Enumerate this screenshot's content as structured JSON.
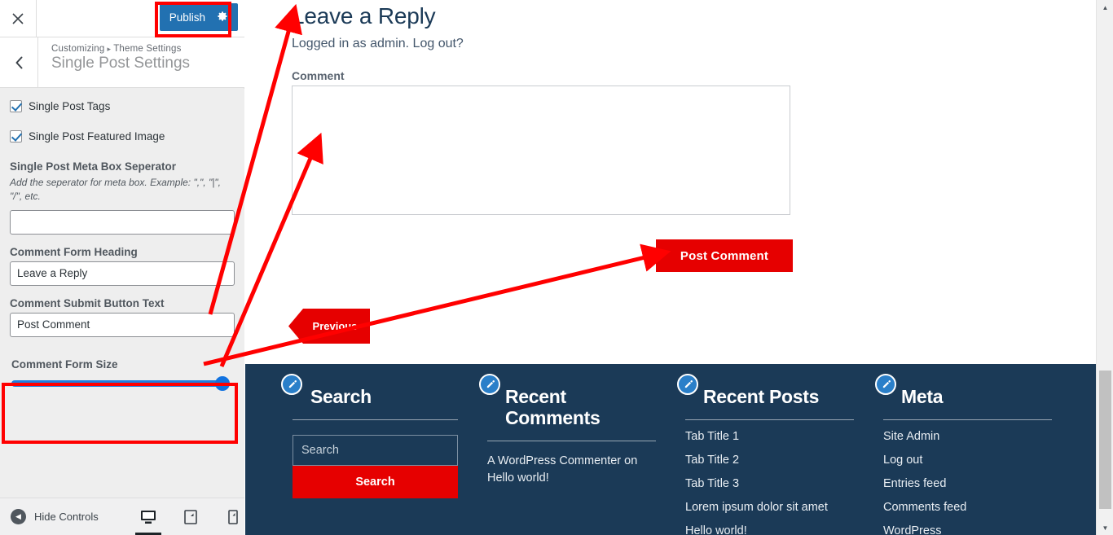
{
  "sidebar": {
    "close_label": "×",
    "publish_label": "Publish",
    "gear_icon": "gear-icon",
    "back_label": "‹",
    "breadcrumb": {
      "parent": "Customizing",
      "separator": "▸",
      "section": "Theme Settings"
    },
    "panel_title": "Single Post Settings",
    "checkboxes": [
      {
        "label": "Single Post Tags",
        "checked": true
      },
      {
        "label": "Single Post Featured Image",
        "checked": true
      }
    ],
    "meta_separator": {
      "label": "Single Post Meta Box Seperator",
      "description": "Add the seperator for meta box. Example: \",\", \"|\", \"/\", etc.",
      "value": "",
      "placeholder": ""
    },
    "comment_form_heading": {
      "label": "Comment Form Heading",
      "value": "Leave a Reply"
    },
    "comment_submit_button_text": {
      "label": "Comment Submit Button Text",
      "value": "Post Comment"
    },
    "comment_form_size": {
      "label": "Comment Form Size",
      "value": 100,
      "min": 0,
      "max": 100
    },
    "footer": {
      "hide_controls_label": "Hide Controls",
      "devices": [
        {
          "name": "desktop",
          "active": true
        },
        {
          "name": "tablet",
          "active": false
        },
        {
          "name": "mobile",
          "active": false
        }
      ]
    }
  },
  "preview": {
    "reply_heading": "Leave a Reply",
    "logged_in_text": "Logged in as admin. Log out?",
    "comment_label": "Comment",
    "comment_value": "",
    "comment_placeholder": "",
    "post_comment_label": "Post Comment",
    "previous_label": "Previous"
  },
  "footer_widgets": [
    {
      "title": "Search",
      "type": "search",
      "search_placeholder": "Search",
      "search_value": "",
      "search_button_label": "Search"
    },
    {
      "title": "Recent Comments",
      "type": "text",
      "text": "A WordPress Commenter on Hello world!"
    },
    {
      "title": "Recent Posts",
      "type": "list",
      "items": [
        "Tab Title 1",
        "Tab Title 2",
        "Tab Title 3",
        "Lorem ipsum dolor sit amet",
        "Hello world!"
      ]
    },
    {
      "title": "Meta",
      "type": "list",
      "items": [
        "Site Admin",
        "Log out",
        "Entries feed",
        "Comments feed",
        "WordPress"
      ]
    }
  ],
  "colors": {
    "publish_blue": "#2271b1",
    "annotation_red": "#ff0000",
    "button_red": "#e60000",
    "footer_navy": "#1b3a57",
    "slider_blue": "#1e7fe0",
    "sidebar_bg": "#eeeeee"
  },
  "annotations": {
    "highlight_publish": "Publish button highlighted",
    "highlight_form_size": "Comment Form Size control highlighted",
    "arrows": [
      "Comment Form Heading field to Leave a Reply heading",
      "Comment Form Size slider to comment textarea",
      "Comment Submit Button Text field to Post Comment button"
    ]
  }
}
